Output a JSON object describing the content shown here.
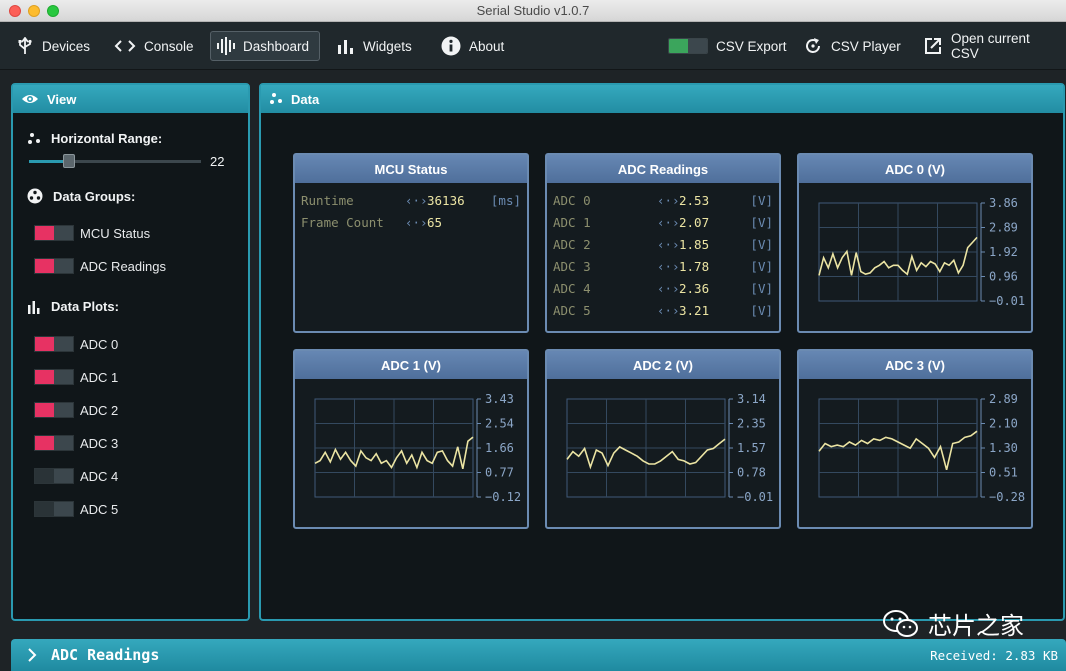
{
  "window": {
    "title": "Serial Studio v1.0.7"
  },
  "toolbar": {
    "devices": "Devices",
    "console": "Console",
    "dashboard": "Dashboard",
    "widgets": "Widgets",
    "about": "About",
    "csv_export": "CSV Export",
    "csv_player": "CSV Player",
    "open_csv": "Open current CSV"
  },
  "view": {
    "title": "View",
    "horizontal_range_label": "Horizontal Range:",
    "horizontal_range_value": "22",
    "horizontal_range_fraction": 0.23,
    "data_groups_label": "Data Groups:",
    "groups": [
      {
        "label": "MCU Status",
        "enabled": true
      },
      {
        "label": "ADC Readings",
        "enabled": true
      }
    ],
    "data_plots_label": "Data Plots:",
    "plots": [
      {
        "label": "ADC 0",
        "enabled": true
      },
      {
        "label": "ADC 1",
        "enabled": true
      },
      {
        "label": "ADC 2",
        "enabled": true
      },
      {
        "label": "ADC 3",
        "enabled": true
      },
      {
        "label": "ADC 4",
        "enabled": false
      },
      {
        "label": "ADC 5",
        "enabled": false
      }
    ]
  },
  "data_panel": {
    "title": "Data"
  },
  "mcu_status": {
    "title": "MCU Status",
    "rows": [
      {
        "label": "Runtime",
        "value": "36136",
        "unit": "[ms]"
      },
      {
        "label": "Frame Count",
        "value": "65",
        "unit": ""
      }
    ]
  },
  "adc_readings": {
    "title": "ADC Readings",
    "rows": [
      {
        "label": "ADC 0",
        "value": "2.53",
        "unit": "[V]"
      },
      {
        "label": "ADC 1",
        "value": "2.07",
        "unit": "[V]"
      },
      {
        "label": "ADC 2",
        "value": "1.85",
        "unit": "[V]"
      },
      {
        "label": "ADC 3",
        "value": "1.78",
        "unit": "[V]"
      },
      {
        "label": "ADC 4",
        "value": "2.36",
        "unit": "[V]"
      },
      {
        "label": "ADC 5",
        "value": "3.21",
        "unit": "[V]"
      }
    ]
  },
  "chart_data": [
    {
      "type": "line",
      "title": "ADC 0 (V)",
      "yticks": [
        "3.86",
        "2.89",
        "1.92",
        "0.96",
        "−0.01"
      ],
      "ylim": [
        -0.01,
        3.86
      ],
      "values": [
        1.0,
        1.7,
        1.3,
        1.85,
        1.3,
        1.7,
        1.95,
        1.0,
        1.9,
        1.15,
        1.05,
        1.1,
        1.3,
        1.4,
        1.55,
        1.3,
        1.4,
        1.4,
        1.2,
        1.05,
        1.75,
        1.2,
        1.5,
        1.35,
        1.55,
        1.45,
        1.15,
        1.5,
        1.4,
        1.6,
        1.1,
        1.4,
        2.1,
        2.3,
        2.5
      ]
    },
    {
      "type": "line",
      "title": "ADC 1 (V)",
      "yticks": [
        "3.43",
        "2.54",
        "1.66",
        "0.77",
        "−0.12"
      ],
      "ylim": [
        -0.12,
        3.43
      ],
      "values": [
        1.1,
        1.2,
        1.5,
        1.15,
        1.6,
        1.25,
        1.5,
        1.2,
        1.0,
        1.55,
        1.3,
        1.2,
        1.45,
        1.1,
        1.2,
        0.95,
        1.3,
        1.55,
        1.1,
        1.4,
        0.95,
        1.5,
        1.2,
        1.1,
        1.5,
        1.55,
        1.2,
        1.0,
        1.7,
        0.9,
        1.9,
        2.05
      ]
    },
    {
      "type": "line",
      "title": "ADC 2 (V)",
      "yticks": [
        "3.14",
        "2.35",
        "1.57",
        "0.78",
        "−0.01"
      ],
      "ylim": [
        -0.01,
        3.14
      ],
      "values": [
        1.2,
        1.45,
        1.3,
        1.55,
        0.95,
        1.5,
        1.4,
        1.0,
        1.4,
        1.6,
        1.5,
        1.4,
        1.3,
        1.15,
        1.05,
        1.05,
        1.15,
        1.3,
        1.45,
        1.2,
        1.15,
        1.05,
        1.1,
        1.3,
        1.5,
        1.55,
        1.7,
        1.85
      ]
    },
    {
      "type": "line",
      "title": "ADC 3 (V)",
      "yticks": [
        "2.89",
        "2.10",
        "1.30",
        "0.51",
        "−0.28"
      ],
      "ylim": [
        -0.28,
        2.89
      ],
      "values": [
        1.2,
        1.45,
        1.35,
        1.4,
        1.35,
        1.5,
        1.4,
        1.55,
        1.45,
        1.6,
        1.55,
        1.65,
        1.6,
        1.5,
        1.4,
        1.3,
        1.6,
        1.45,
        1.3,
        1.0,
        1.35,
        0.6,
        1.45,
        1.5,
        1.65,
        1.7,
        1.85
      ]
    }
  ],
  "status_bar": {
    "title": "ADC Readings",
    "received": "Received: 2.83 KB"
  },
  "watermark": {
    "text": "芯片之家"
  }
}
